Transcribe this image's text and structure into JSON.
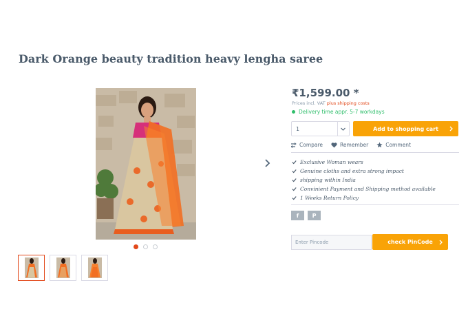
{
  "product": {
    "title": "Dark Orange beauty tradition heavy lengha saree",
    "price": "₹1,599.00 *",
    "vat_prefix": "Prices incl. VAT ",
    "vat_link": "plus shipping costs",
    "delivery": "Delivery time appr. 5-7 workdays"
  },
  "buy": {
    "quantity": "1",
    "cart_label": "Add to shopping cart"
  },
  "actions": {
    "compare": "Compare",
    "remember": "Remember",
    "comment": "Comment"
  },
  "features": [
    "Exclusive Woman wears",
    "Genuine cloths and extra strong impact",
    "shipping within India",
    "Convinient Payment and Shipping method available",
    "1 Weeks Return Policy"
  ],
  "social": {
    "facebook": "f",
    "pinterest": "P"
  },
  "pincode": {
    "placeholder": "Enter Pincode",
    "button_label": "check PinCode"
  },
  "gallery": {
    "slide_count": 3,
    "active_slide": 1,
    "thumb_count": 3
  },
  "colors": {
    "accent": "#f9a307",
    "highlight": "#e2491b",
    "delivery": "#2fbe6b"
  }
}
